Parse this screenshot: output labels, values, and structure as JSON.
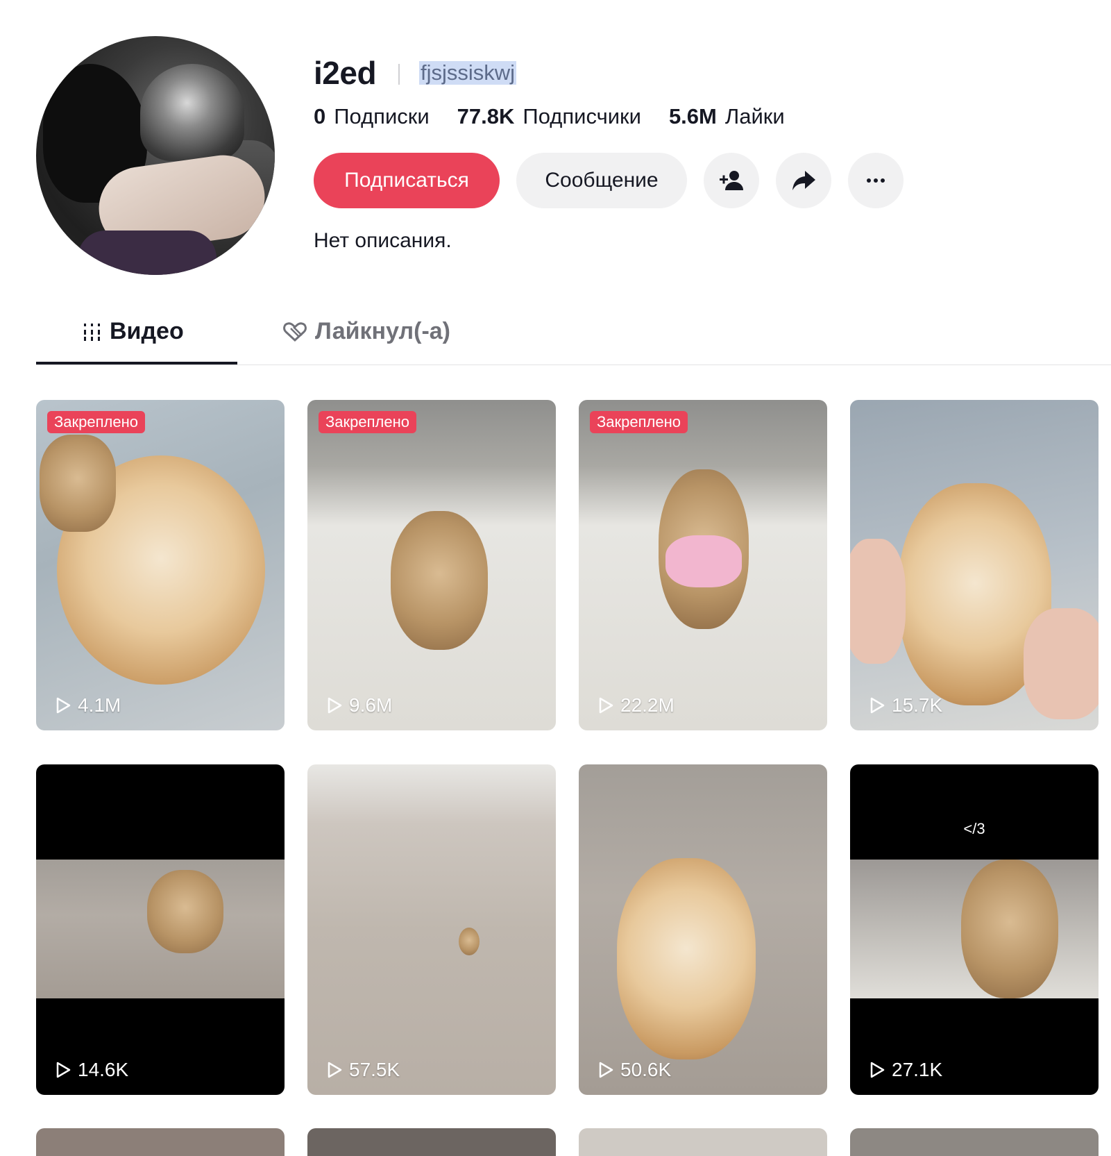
{
  "profile": {
    "username": "i2ed",
    "nickname": "fjsjssiskwj",
    "stats": [
      {
        "value": "0",
        "label": "Подписки"
      },
      {
        "value": "77.8K",
        "label": "Подписчики"
      },
      {
        "value": "5.6M",
        "label": "Лайки"
      }
    ],
    "follow_label": "Подписаться",
    "message_label": "Сообщение",
    "bio": "Нет описания."
  },
  "tabs": [
    {
      "label": "Видео",
      "icon": "grid-icon",
      "active": true
    },
    {
      "label": "Лайкнул(-а)",
      "icon": "liked-heart-icon",
      "active": false
    }
  ],
  "videos": [
    {
      "pinned_label": "Закреплено",
      "views": "4.1M"
    },
    {
      "pinned_label": "Закреплено",
      "views": "9.6M"
    },
    {
      "pinned_label": "Закреплено",
      "views": "22.2M"
    },
    {
      "pinned_label": "",
      "views": "15.7K"
    },
    {
      "pinned_label": "",
      "views": "14.6K"
    },
    {
      "pinned_label": "",
      "views": "57.5K"
    },
    {
      "pinned_label": "",
      "views": "50.6K"
    },
    {
      "pinned_label": "",
      "views": "27.1K",
      "caption": "</3"
    }
  ],
  "colors": {
    "accent": "#ea4359",
    "text": "#161823",
    "muted": "#707178",
    "button_bg": "#f1f1f2"
  }
}
